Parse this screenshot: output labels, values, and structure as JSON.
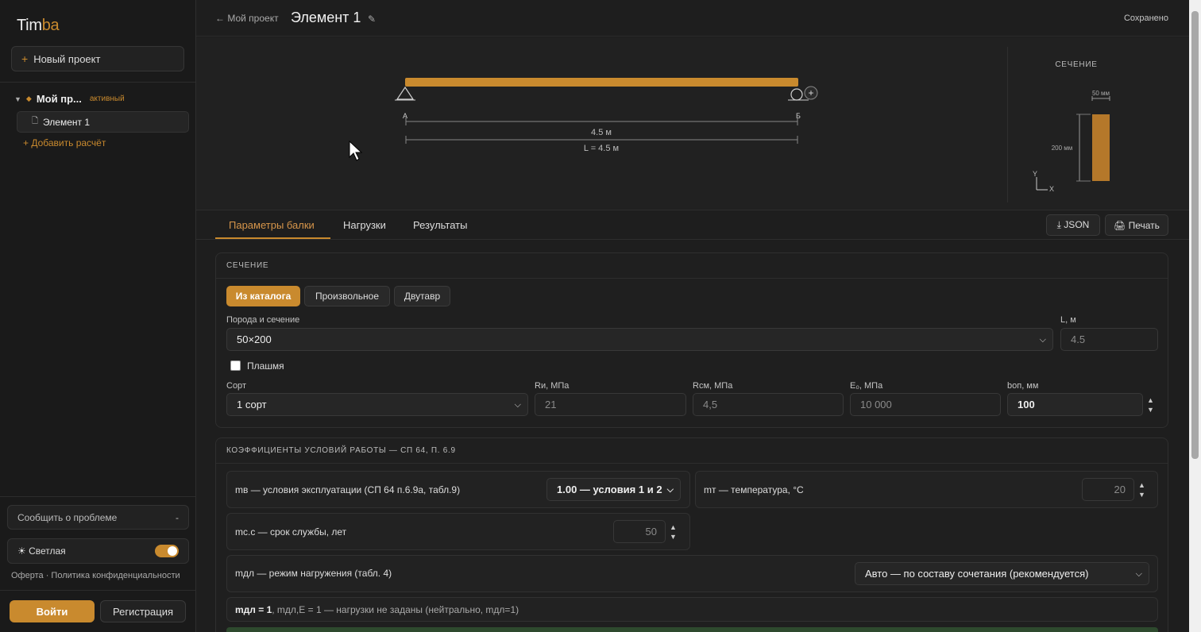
{
  "sidebar": {
    "logo_a": "Tim",
    "logo_b": "ba",
    "new_project": "Новый проект",
    "project_name": "Мой пр...",
    "project_badge": "активный",
    "element": "Элемент 1",
    "add_calc": "+ Добавить расчёт",
    "report": "Сообщить о проблеме",
    "report_arrow": "-",
    "theme": "☀ Светлая",
    "legal": "Оферта · Политика конфиденциальности",
    "login": "Войти",
    "register": "Регистрация"
  },
  "header": {
    "back": "← Мой проект",
    "title": "Элемент 1",
    "saved": "Сохранено"
  },
  "diagram": {
    "support_a": "А",
    "support_b": "Б",
    "span": "4.5 м",
    "total": "L = 4.5 м",
    "section_title": "СЕЧЕНИЕ",
    "width": "50 мм",
    "height": "200 мм",
    "axis_y": "Y",
    "axis_x": "X",
    "beam_color": "#c98a2e"
  },
  "tabs": [
    "Параметры балки",
    "Нагрузки",
    "Результаты"
  ],
  "toolbar": {
    "json": "⤓ JSON",
    "print": "🖨 Печать"
  },
  "section_card": {
    "title": "СЕЧЕНИЕ",
    "modes": [
      "Из каталога",
      "Произвольное",
      "Двутавр"
    ],
    "species_label": "Порода и сечение",
    "species_value": "50×200",
    "length_label": "L, м",
    "length_value": "4.5",
    "flat_label": "Плашмя",
    "grade_label": "Сорт",
    "grade_value": "1 сорт",
    "ri_label": "Rи, МПа",
    "ri_value": "21",
    "rcm_label": "Rсм, МПа",
    "rcm_value": "4,5",
    "e_label": "E₀, МПа",
    "e_value": "10 000",
    "bop_label": "bоп, мм",
    "bop_value": "100"
  },
  "coef_card": {
    "title": "КОЭФФИЦИЕНТЫ УСЛОВИЙ РАБОТЫ — СП 64, П. 6.9",
    "mv_label": "mв — условия эксплуатации (СП 64 п.6.9а, табл.9)",
    "mv_value": "1.00 — условия 1 и 2",
    "mt_label": "mт — температура, °C",
    "mt_value": "20",
    "mss_label": "mс.с — срок службы, лет",
    "mss_value": "50",
    "mdl_label": "mдл — режим нагружения (табл. 4)",
    "mdl_value": "Авто — по составу сочетания (рекомендуется)",
    "result_bold": "mдл = 1",
    "result_rest": ", mдл,E = 1 — нагрузки не заданы (нейтрально, mдл=1)"
  }
}
